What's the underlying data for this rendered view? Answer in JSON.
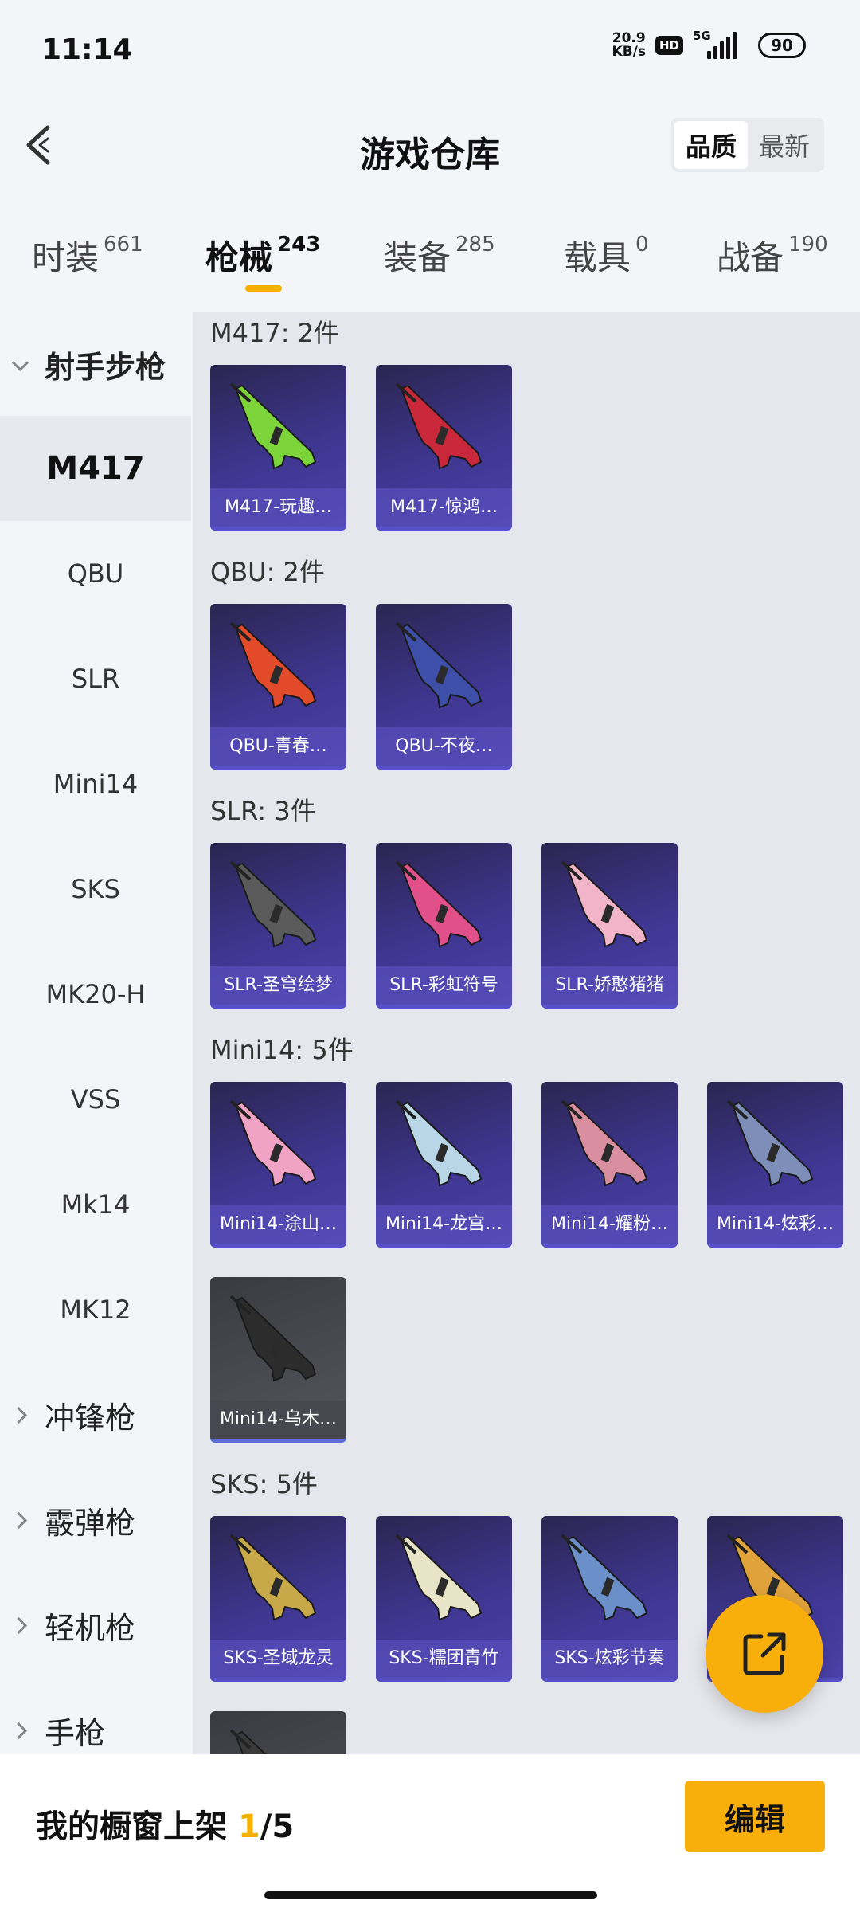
{
  "status_bar": {
    "time": "11:14",
    "net_speed_value": "20.9",
    "net_speed_unit": "KB/s",
    "hd": "HD",
    "network": "5G",
    "battery": "90"
  },
  "header": {
    "title": "游戏仓库",
    "sort_options": [
      "品质",
      "最新"
    ],
    "active_sort": "品质"
  },
  "tabs": [
    {
      "label": "时装",
      "count": "661"
    },
    {
      "label": "枪械",
      "count": "243"
    },
    {
      "label": "装备",
      "count": "285"
    },
    {
      "label": "载具",
      "count": "0"
    },
    {
      "label": "战备",
      "count": "190"
    }
  ],
  "active_tab": "枪械",
  "sidebar": {
    "expanded_group": "射手步枪",
    "items": [
      "M417",
      "QBU",
      "SLR",
      "Mini14",
      "SKS",
      "MK20-H",
      "VSS",
      "Mk14",
      "MK12"
    ],
    "active_item": "M417",
    "collapsed_groups": [
      "冲锋枪",
      "霰弹枪",
      "轻机枪",
      "手枪"
    ]
  },
  "sections": [
    {
      "title": "M417: 2件",
      "items": [
        {
          "name": "M417-玩趣…",
          "accent": "#7cd43a"
        },
        {
          "name": "M417-惊鸿…",
          "accent": "#c9283b"
        }
      ]
    },
    {
      "title": "QBU: 2件",
      "items": [
        {
          "name": "QBU-青春…",
          "accent": "#e24a2a"
        },
        {
          "name": "QBU-不夜…",
          "accent": "#3d4fa8"
        }
      ]
    },
    {
      "title": "SLR: 3件",
      "items": [
        {
          "name": "SLR-圣穹绘梦",
          "accent": "#5a5a5a"
        },
        {
          "name": "SLR-彩虹符号",
          "accent": "#e2508c"
        },
        {
          "name": "SLR-娇憨猪猪",
          "accent": "#f2b4c8"
        }
      ]
    },
    {
      "title": "Mini14: 5件",
      "items": [
        {
          "name": "Mini14-涂山…",
          "accent": "#f0a3c4"
        },
        {
          "name": "Mini14-龙宫…",
          "accent": "#b8d6e6"
        },
        {
          "name": "Mini14-耀粉…",
          "accent": "#d98fa0"
        },
        {
          "name": "Mini14-炫彩…",
          "accent": "#7d8fb8"
        },
        {
          "name": "Mini14-乌木…",
          "accent": "#2c2c2c",
          "grey": true
        }
      ]
    },
    {
      "title": "SKS: 5件",
      "items": [
        {
          "name": "SKS-圣域龙灵",
          "accent": "#c8a94a"
        },
        {
          "name": "SKS-糯团青竹",
          "accent": "#e8e4c8"
        },
        {
          "name": "SKS-炫彩节奏",
          "accent": "#6b8fc8"
        },
        {
          "name": "",
          "accent": "#e0a23a"
        },
        {
          "name": "",
          "accent": "#3a3a3a",
          "grey": true
        }
      ]
    }
  ],
  "footer": {
    "showcase_label": "我的橱窗上架",
    "showcase_current": "1",
    "showcase_total": "/5",
    "edit_label": "编辑"
  }
}
